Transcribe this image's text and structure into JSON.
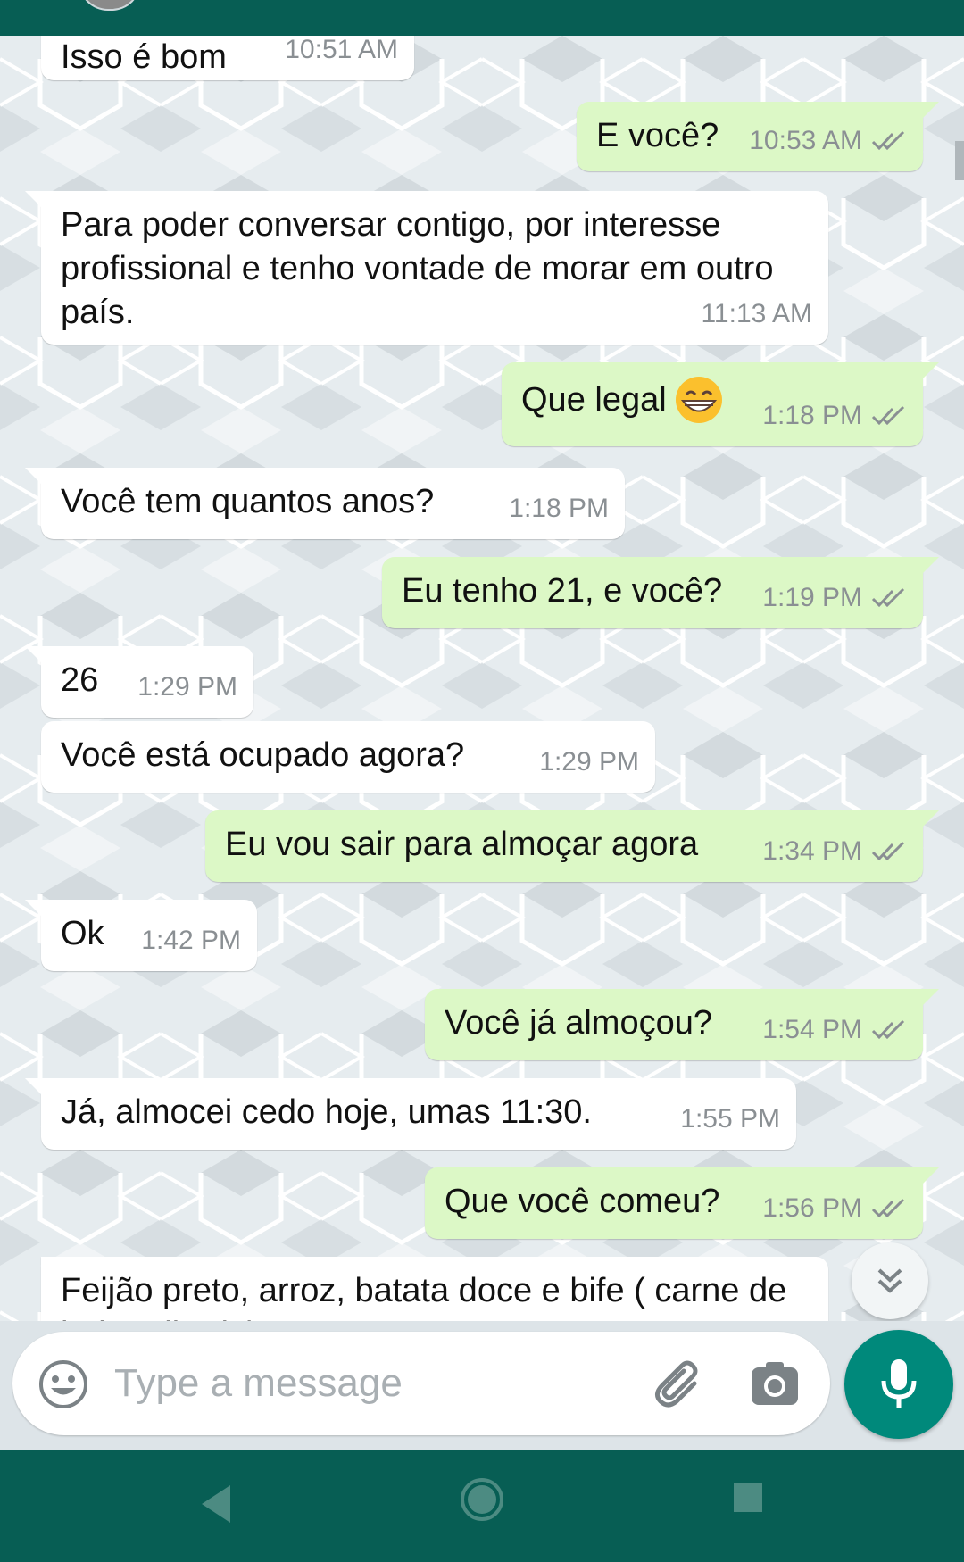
{
  "messages": [
    {
      "dir": "in",
      "text": "Isso é bom",
      "time": "10:51 AM",
      "tail": false
    },
    {
      "dir": "out",
      "text": "E você?",
      "time": "10:53 AM",
      "tail": true
    },
    {
      "dir": "in",
      "text": "Para poder conversar contigo, por interesse profissional e tenho vontade de morar em outro país.",
      "time": "11:13 AM",
      "tail": true
    },
    {
      "dir": "out",
      "text": "Que legal",
      "time": "1:18 PM",
      "tail": true,
      "emoji": "grinning-face-emoji"
    },
    {
      "dir": "in",
      "text": "Você tem quantos anos?",
      "time": "1:18 PM",
      "tail": true
    },
    {
      "dir": "out",
      "text": "Eu tenho 21, e você?",
      "time": "1:19 PM",
      "tail": true
    },
    {
      "dir": "in",
      "text": "26",
      "time": "1:29 PM",
      "tail": true
    },
    {
      "dir": "in",
      "text": "Você está ocupado agora?",
      "time": "1:29 PM",
      "tail": false
    },
    {
      "dir": "out",
      "text": "Eu vou sair para almoçar agora",
      "time": "1:34 PM",
      "tail": true
    },
    {
      "dir": "in",
      "text": "Ok",
      "time": "1:42 PM",
      "tail": true
    },
    {
      "dir": "out",
      "text": "Você já almoçou?",
      "time": "1:54 PM",
      "tail": true
    },
    {
      "dir": "in",
      "text": "Já, almocei cedo hoje, umas 11:30.",
      "time": "1:55 PM",
      "tail": true
    },
    {
      "dir": "out",
      "text": "Que você comeu?",
      "time": "1:56 PM",
      "tail": true
    },
    {
      "dir": "in",
      "text": "Feijão preto, arroz, batata doce e bife ( carne de boi grelhada)",
      "time": "",
      "tail": true
    }
  ],
  "status_icon": "double-check-icon",
  "input": {
    "placeholder": "Type a message"
  },
  "icons": {
    "emoji_button": "smiley-icon",
    "attach": "paperclip-icon",
    "camera": "camera-icon",
    "mic": "microphone-icon",
    "scroll_down": "double-chevron-down-icon",
    "nav_back": "back-triangle-icon",
    "nav_home": "home-circle-icon",
    "nav_recents": "recents-square-icon"
  },
  "colors": {
    "header": "#075e54",
    "outgoing_bubble": "#dcf8c6",
    "incoming_bubble": "#ffffff",
    "mic_button": "#00897b",
    "tick_read": "#8a8f93"
  }
}
